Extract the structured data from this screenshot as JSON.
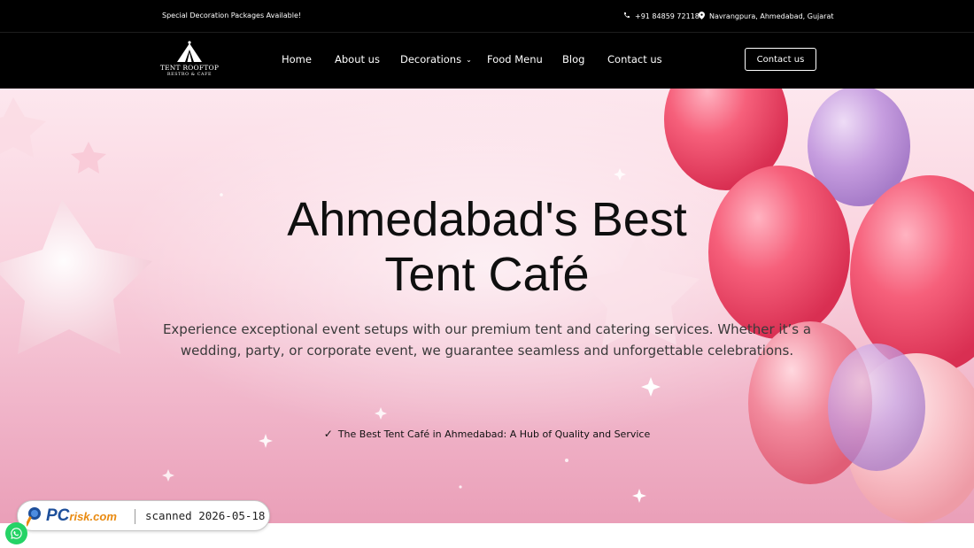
{
  "topbar": {
    "promo": "Special Decoration Packages Available!",
    "phone": "+91 84859 72118",
    "address": "Navrangpura, Ahmedabad, Gujarat"
  },
  "logo": {
    "line1": "TENT ROOFTOP",
    "line2": "RESTRO & CAFE"
  },
  "nav": {
    "items": [
      "Home",
      "About us",
      "Decorations",
      "Food Menu",
      "Blog",
      "Contact us"
    ],
    "cta": "Contact us"
  },
  "hero": {
    "title_line1": "Ahmedabad's Best",
    "title_line2": "Tent Café",
    "description": "Experience exceptional event setups with our premium tent and catering services. Whether it’s a wedding, party, or corporate event, we guarantee seamless and unforgettable celebrations.",
    "feature": "The Best Tent Café in Ahmedabad: A Hub of Quality and Service"
  },
  "badge": {
    "brand_main": "PC",
    "brand_sub": "risk.com",
    "scan_text": "scanned 2026-05-18"
  },
  "icons": [
    "phone-icon",
    "location-pin-icon",
    "tent-logo-icon",
    "chevron-down-icon",
    "checkmark-icon",
    "magnifier-icon",
    "whatsapp-icon"
  ],
  "colors": {
    "header_bg": "#000000",
    "hero_pink": "#f9d2de",
    "whatsapp_green": "#25d366",
    "pcrisk_blue": "#1d4f9a",
    "pcrisk_orange": "#e98a10"
  }
}
